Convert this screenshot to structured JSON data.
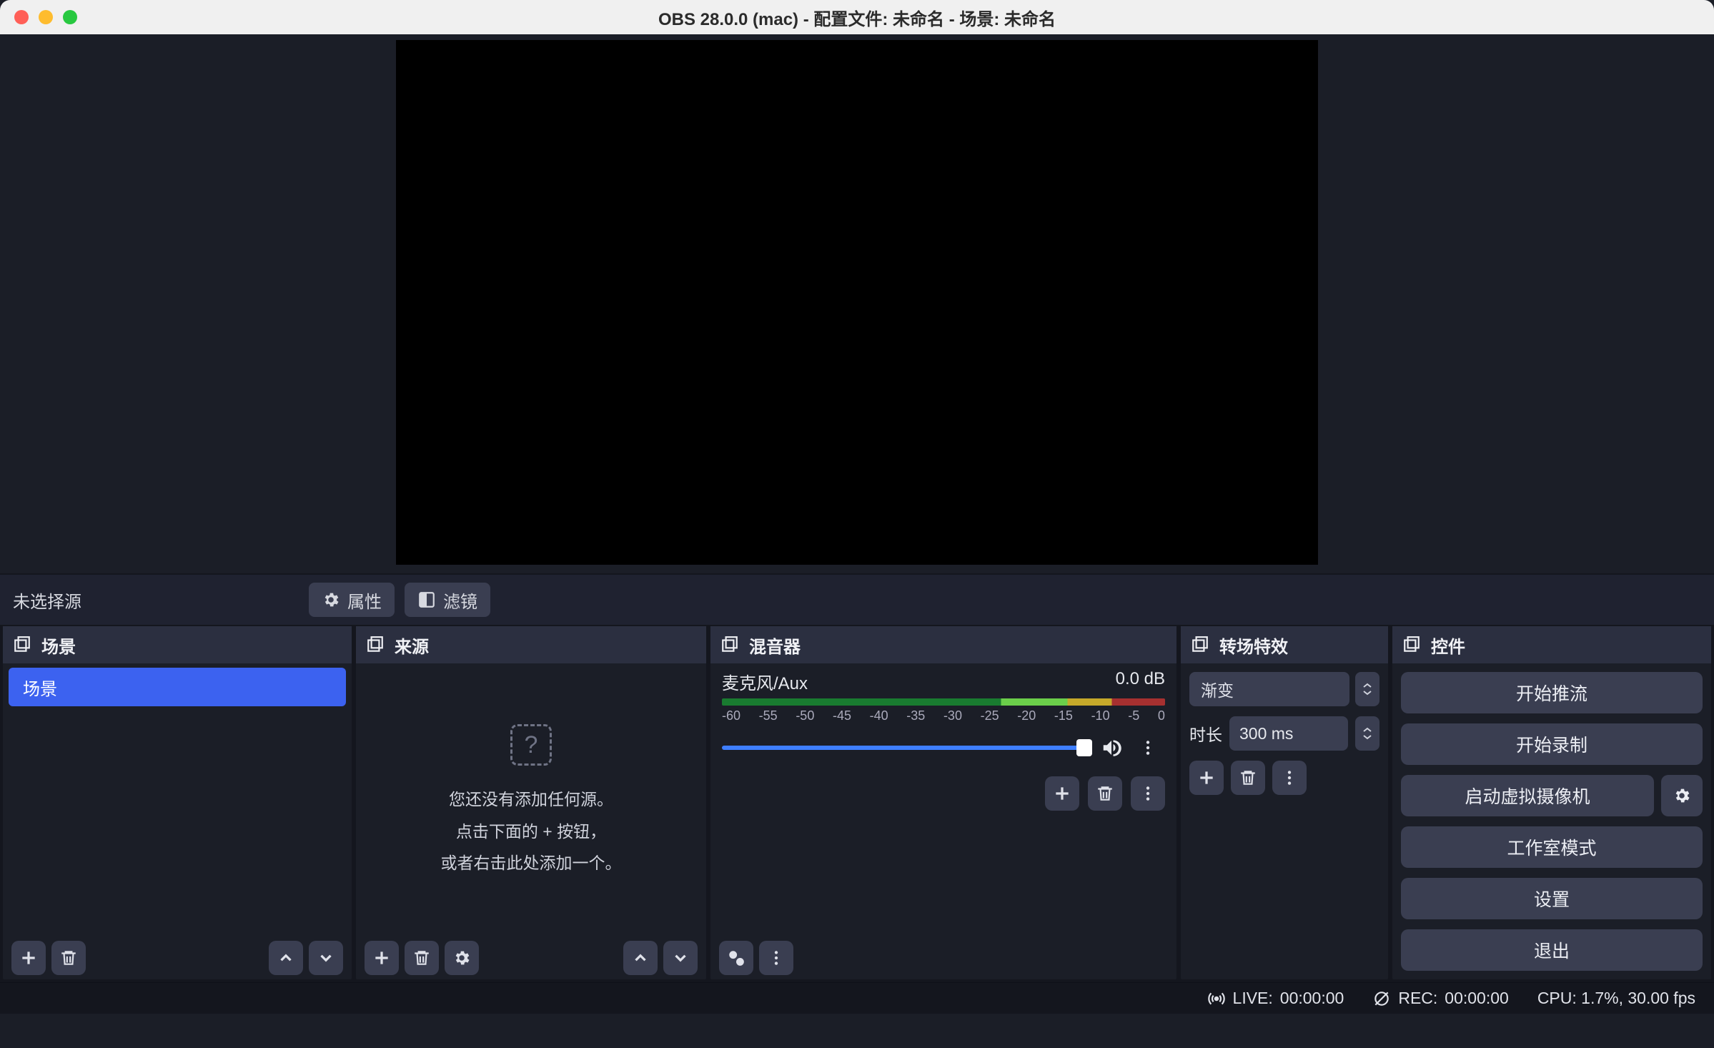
{
  "window": {
    "title": "OBS 28.0.0 (mac) - 配置文件: 未命名 - 场景: 未命名"
  },
  "toolbar": {
    "no_source_selected": "未选择源",
    "properties": "属性",
    "filters": "滤镜"
  },
  "docks": {
    "scenes": {
      "title": "场景",
      "items": [
        "场景"
      ]
    },
    "sources": {
      "title": "来源",
      "empty_line1": "您还没有添加任何源。",
      "empty_line2": "点击下面的 + 按钮，",
      "empty_line3": "或者右击此处添加一个。"
    },
    "mixer": {
      "title": "混音器",
      "channel_name": "麦克风/Aux",
      "channel_level": "0.0 dB",
      "ticks": [
        "-60",
        "-55",
        "-50",
        "-45",
        "-40",
        "-35",
        "-30",
        "-25",
        "-20",
        "-15",
        "-10",
        "-5",
        "0"
      ]
    },
    "transitions": {
      "title": "转场特效",
      "selected": "渐变",
      "duration_label": "时长",
      "duration_value": "300 ms"
    },
    "controls": {
      "title": "控件",
      "start_stream": "开始推流",
      "start_record": "开始录制",
      "start_vcam": "启动虚拟摄像机",
      "studio_mode": "工作室模式",
      "settings": "设置",
      "exit": "退出"
    }
  },
  "status": {
    "live_label": "LIVE:",
    "live_time": "00:00:00",
    "rec_label": "REC:",
    "rec_time": "00:00:00",
    "cpu": "CPU: 1.7%, 30.00 fps"
  }
}
